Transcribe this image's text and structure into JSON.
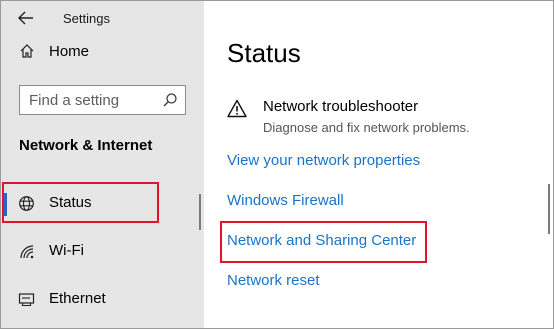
{
  "window": {
    "title": "Settings"
  },
  "sidebar": {
    "home_label": "Home",
    "search": {
      "placeholder": "Find a setting"
    },
    "section_title": "Network & Internet",
    "items": [
      {
        "label": "Status",
        "icon": "globe-icon",
        "selected": true
      },
      {
        "label": "Wi-Fi",
        "icon": "wifi-icon",
        "selected": false
      },
      {
        "label": "Ethernet",
        "icon": "ethernet-icon",
        "selected": false
      }
    ]
  },
  "main": {
    "title": "Status",
    "troubleshooter": {
      "title": "Network troubleshooter",
      "description": "Diagnose and fix network problems."
    },
    "links": [
      "View your network properties",
      "Windows Firewall",
      "Network and Sharing Center",
      "Network reset"
    ]
  },
  "colors": {
    "accent": "#2b65c7",
    "link": "#1a73c8",
    "highlight": "#e0142b",
    "sidebar_bg": "#e6e6e6"
  }
}
